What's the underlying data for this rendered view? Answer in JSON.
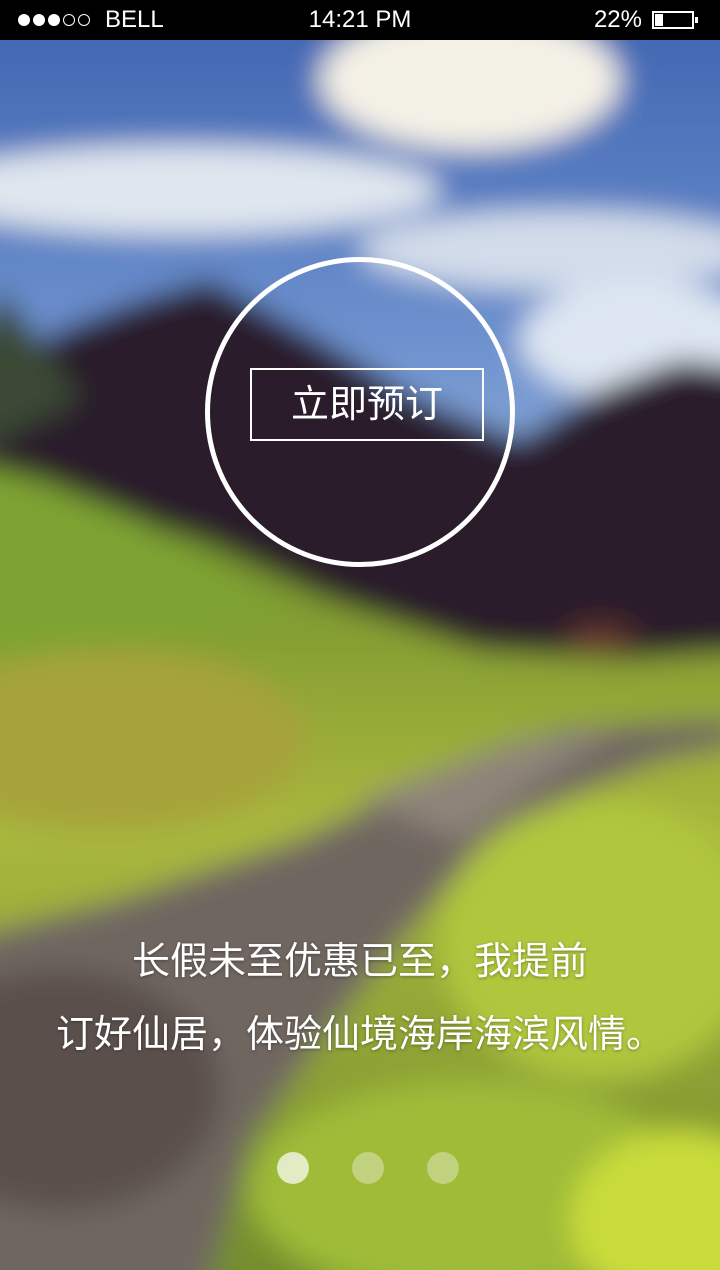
{
  "status_bar": {
    "signal_dots_filled": 3,
    "signal_dots_total": 5,
    "carrier": "BELL",
    "time": "14:21 PM",
    "battery_percent": "22%",
    "battery_level": 0.22
  },
  "main": {
    "book_button_label": "立即预订",
    "caption_line1": "长假未至优惠已至，我提前",
    "caption_line2": "订好仙居，体验仙境海岸海滨风情。"
  },
  "pager": {
    "pages": 3,
    "active_index": 0
  },
  "background": {
    "description_colors": {
      "sky": "#3a66b4",
      "mountain": "#2a1e2a",
      "grass": "#8fb23a",
      "path": "#6b625c"
    }
  }
}
